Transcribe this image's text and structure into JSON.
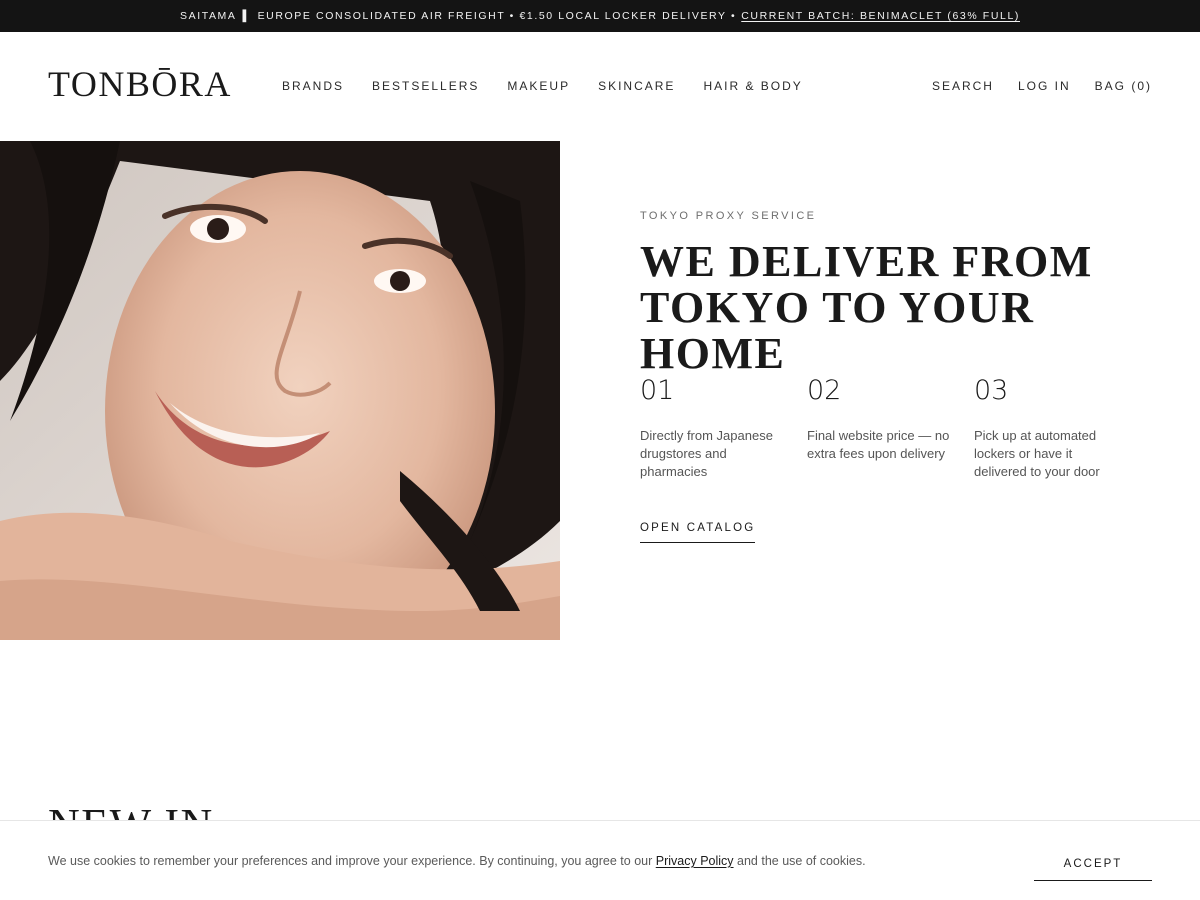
{
  "announcement": {
    "left_text": "SAITAMA",
    "separator": "▌",
    "middle_text": "EUROPE CONSOLIDATED AIR FREIGHT • €1.50 LOCAL LOCKER DELIVERY •",
    "batch_link": "CURRENT BATCH: BENIMACLET (63% FULL)"
  },
  "header": {
    "logo": "TONBŌRA",
    "nav": [
      "BRANDS",
      "BESTSELLERS",
      "MAKEUP",
      "SKINCARE",
      "HAIR & BODY"
    ],
    "search": "SEARCH",
    "login": "LOG IN",
    "bag": "BAG (0)"
  },
  "hero": {
    "image_alt": "portrait of smiling woman resting head on hands",
    "eyebrow": "TOKYO PROXY SERVICE",
    "headline_line1": "WE DELIVER FROM",
    "headline_line2": "TOKYO TO YOUR HOME",
    "steps": [
      {
        "num": "01",
        "text": "Directly from Japanese drugstores and pharmacies"
      },
      {
        "num": "02",
        "text": "Final website price — no extra fees upon delivery"
      },
      {
        "num": "03",
        "text": "Pick up at automated lockers or have it delivered to your door"
      }
    ],
    "cta": "OPEN CATALOG"
  },
  "section": {
    "new_in": "NEW IN"
  },
  "cookie": {
    "text_before": "We use cookies to remember your preferences and improve your experience. By continuing, you agree to our",
    "link": "Privacy Policy",
    "text_after": "and the use of cookies.",
    "accept": "ACCEPT"
  },
  "colors": {
    "announcement_bg": "#141414",
    "text": "#1a1a1a",
    "muted": "#555555",
    "background": "#ffffff"
  }
}
